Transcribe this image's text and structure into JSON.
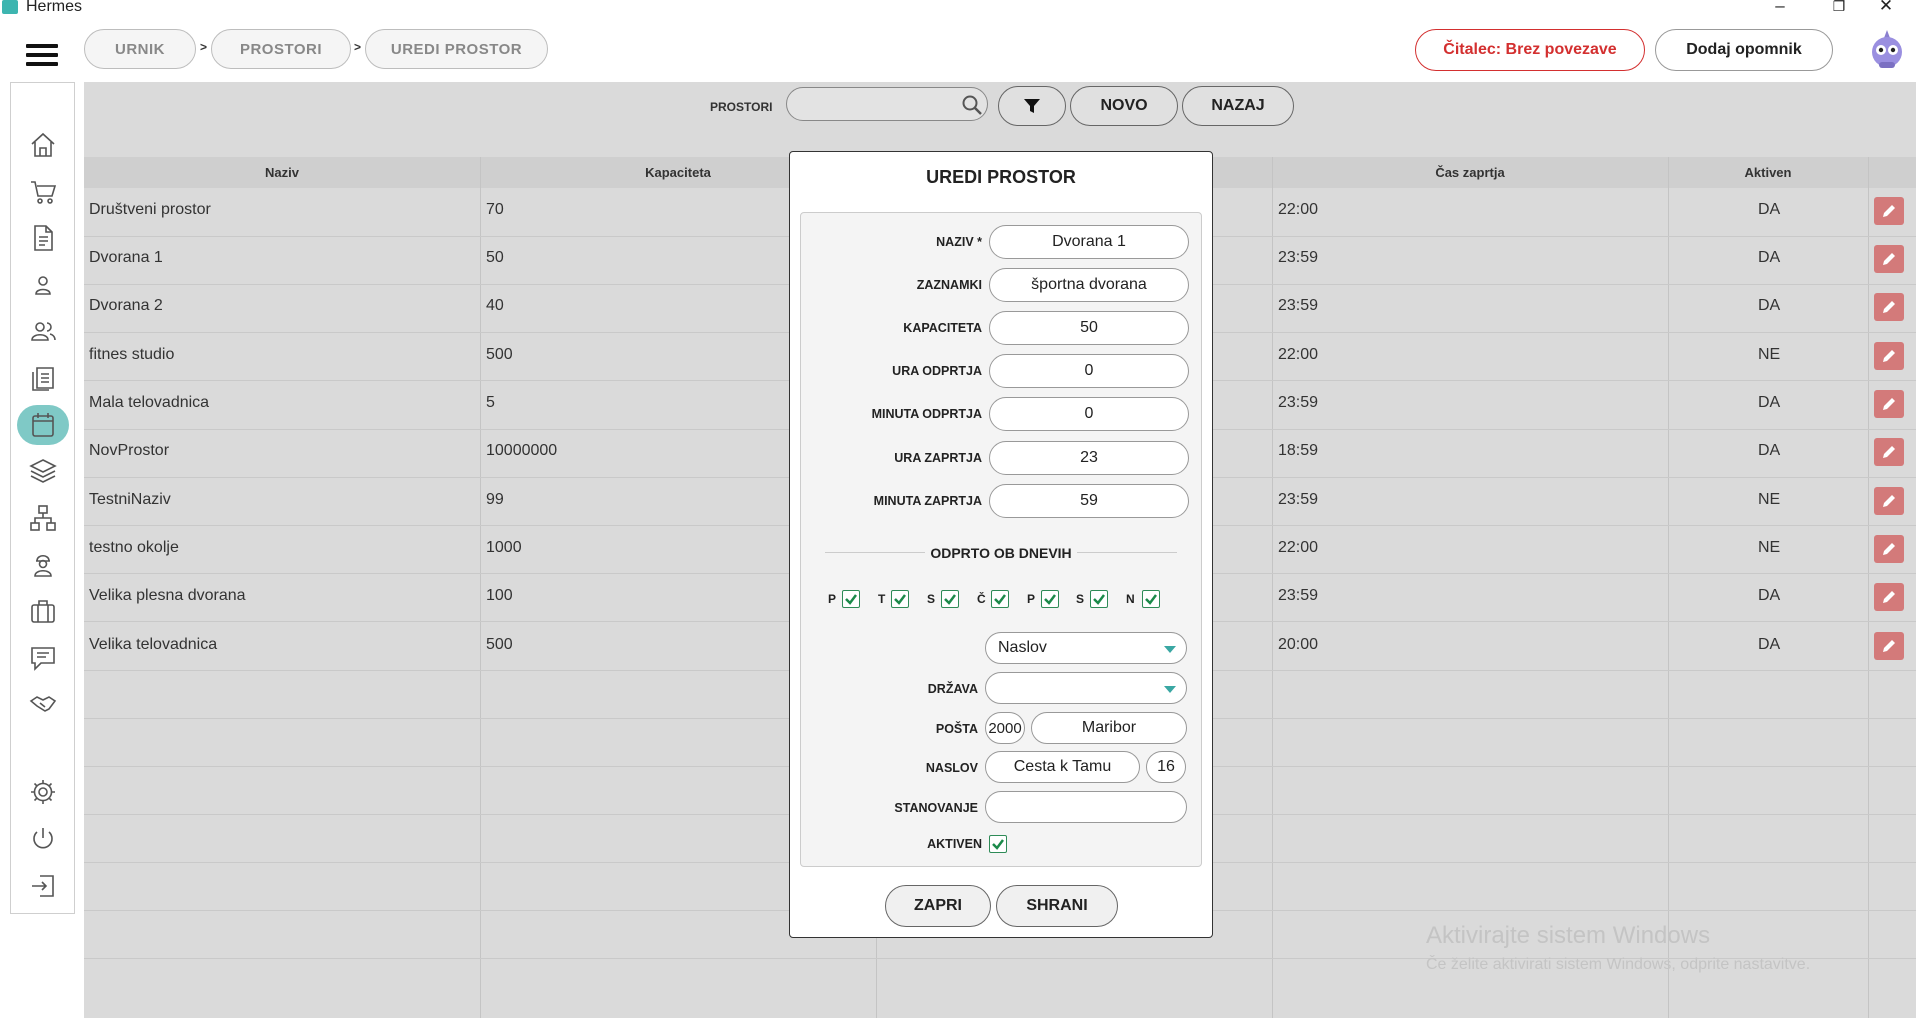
{
  "window": {
    "title": "Hermes",
    "controls": [
      "–",
      "❐",
      "✕"
    ]
  },
  "breadcrumb": {
    "items": [
      "URNIK",
      "PROSTORI",
      "UREDI PROSTOR"
    ],
    "separator": ">"
  },
  "header": {
    "reader_label": "Čitalec: Brez povezave",
    "reminder_label": "Dodaj opomnik"
  },
  "sidebar": {
    "icons": [
      "home-icon",
      "cart-icon",
      "document-icon",
      "user-icon",
      "users-icon",
      "list-icon",
      "calendar-icon",
      "layers-icon",
      "hierarchy-icon",
      "worker-icon",
      "briefcase-icon",
      "chat-icon",
      "handshake-icon",
      "gear-icon",
      "power-icon",
      "logout-icon"
    ],
    "active": "calendar-icon"
  },
  "toolbar": {
    "label": "PROSTORI",
    "search_value": "",
    "novo_label": "NOVO",
    "nazaj_label": "NAZAJ"
  },
  "table": {
    "headers": {
      "naziv": "Naziv",
      "kapaciteta": "Kapaciteta",
      "cas_zaprtja": "Čas zaprtja",
      "aktiven": "Aktiven"
    },
    "rows": [
      {
        "naziv": "Društveni prostor",
        "kapaciteta": "70",
        "cas": "22:00",
        "aktiven": "DA"
      },
      {
        "naziv": "Dvorana 1",
        "kapaciteta": "50",
        "cas": "23:59",
        "aktiven": "DA"
      },
      {
        "naziv": "Dvorana 2",
        "kapaciteta": "40",
        "cas": "23:59",
        "aktiven": "DA"
      },
      {
        "naziv": "fitnes studio",
        "kapaciteta": "500",
        "cas": "22:00",
        "aktiven": "NE"
      },
      {
        "naziv": "Mala telovadnica",
        "kapaciteta": "5",
        "cas": "23:59",
        "aktiven": "DA"
      },
      {
        "naziv": "NovProstor",
        "kapaciteta": "10000000",
        "cas": "18:59",
        "aktiven": "DA"
      },
      {
        "naziv": "TestniNaziv",
        "kapaciteta": "99",
        "cas": "23:59",
        "aktiven": "NE"
      },
      {
        "naziv": "testno okolje",
        "kapaciteta": "1000",
        "cas": "22:00",
        "aktiven": "NE"
      },
      {
        "naziv": "Velika plesna dvorana",
        "kapaciteta": "100",
        "cas": "23:59",
        "aktiven": "DA"
      },
      {
        "naziv": "Velika telovadnica",
        "kapaciteta": "500",
        "cas": "20:00",
        "aktiven": "DA"
      }
    ]
  },
  "modal": {
    "title": "UREDI PROSTOR",
    "fields": {
      "naziv": {
        "label": "NAZIV *",
        "value": "Dvorana 1"
      },
      "zaznamki": {
        "label": "ZAZNAMKI",
        "value": "športna dvorana"
      },
      "kapaciteta": {
        "label": "KAPACITETA",
        "value": "50"
      },
      "ura_odprtja": {
        "label": "URA ODPRTJA",
        "value": "0"
      },
      "minuta_odprtja": {
        "label": "MINUTA ODPRTJA",
        "value": "0"
      },
      "ura_zaprtja": {
        "label": "URA ZAPRTJA",
        "value": "23"
      },
      "minuta_zaprtja": {
        "label": "MINUTA ZAPRTJA",
        "value": "59"
      }
    },
    "days_title": "ODPRTO OB DNEVIH",
    "days": [
      {
        "label": "P",
        "checked": true
      },
      {
        "label": "T",
        "checked": true
      },
      {
        "label": "S",
        "checked": true
      },
      {
        "label": "Č",
        "checked": true
      },
      {
        "label": "P",
        "checked": true
      },
      {
        "label": "S",
        "checked": true
      },
      {
        "label": "N",
        "checked": true
      }
    ],
    "address": {
      "naslov_select": "Naslov",
      "drzava_label": "DRŽAVA",
      "drzava_value": "",
      "posta_label": "POŠTA",
      "posta_code": "2000",
      "posta_city": "Maribor",
      "naslov_label": "NASLOV",
      "street": "Cesta k Tamu",
      "number": "16",
      "stanovanje_label": "STANOVANJE",
      "stanovanje_value": "",
      "aktiven_label": "AKTIVEN",
      "aktiven_checked": true
    },
    "close_label": "ZAPRI",
    "save_label": "SHRANI"
  },
  "watermark": {
    "line1": "Aktivirajte sistem Windows",
    "line2": "Če želite aktivirati sistem Windows, odprite nastavitve."
  },
  "colors": {
    "accent": "#3aa7a3",
    "danger": "#d32f2f",
    "edit": "#d37a7a",
    "check": "#1b8a4a"
  }
}
